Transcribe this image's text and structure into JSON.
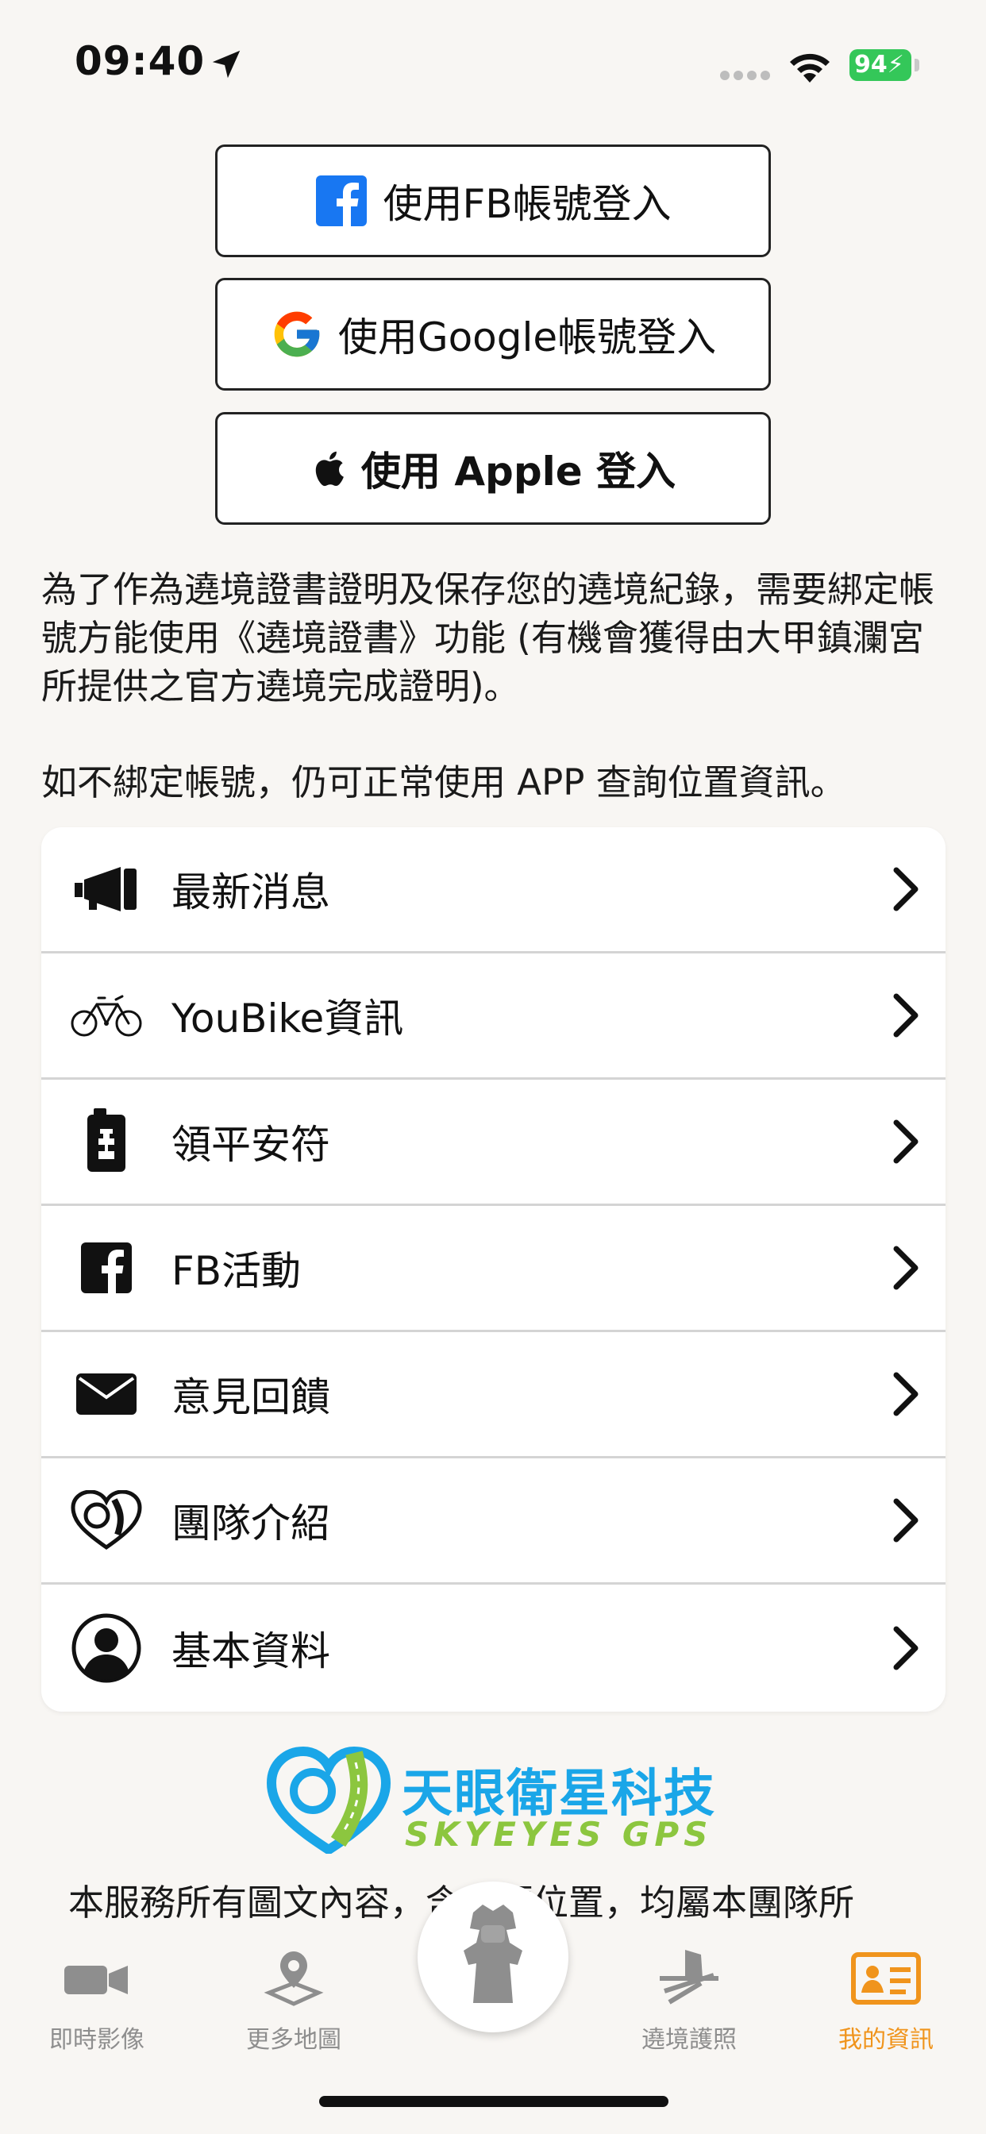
{
  "status_bar": {
    "time": "09:40",
    "battery": "94"
  },
  "login": {
    "fb_label": "使用FB帳號登入",
    "google_label": "使用Google帳號登入",
    "apple_label": "使用 Apple 登入"
  },
  "info": {
    "paragraph1": "為了作為遶境證書證明及保存您的遶境紀錄，需要綁定帳號方能使用《遶境證書》功能 (有機會獲得由大甲鎮瀾宮所提供之官方遶境完成證明)。",
    "paragraph2": "如不綁定帳號，仍可正常使用 APP 查詢位置資訊。"
  },
  "menu": {
    "items": [
      {
        "label": "最新消息",
        "icon": "megaphone-icon"
      },
      {
        "label": "YouBike資訊",
        "icon": "bicycle-icon"
      },
      {
        "label": "領平安符",
        "icon": "amulet-icon"
      },
      {
        "label": "FB活動",
        "icon": "facebook-icon"
      },
      {
        "label": "意見回饋",
        "icon": "envelope-icon"
      },
      {
        "label": "團隊介紹",
        "icon": "team-logo-icon"
      },
      {
        "label": "基本資料",
        "icon": "user-profile-icon"
      }
    ]
  },
  "brand": {
    "name_cn": "天眼衛星科技",
    "name_en": "SKYEYES GPS"
  },
  "footer": {
    "text": "本服務所有圖文內容，含坐標位置，均屬本團隊所"
  },
  "tab_bar": {
    "tabs": [
      {
        "label": "即時影像",
        "icon": "video-camera-icon"
      },
      {
        "label": "更多地圖",
        "icon": "map-pin-icon"
      },
      {
        "label": "遶境護照",
        "icon": "passport-icon"
      },
      {
        "label": "我的資訊",
        "icon": "id-card-icon"
      }
    ],
    "active_color": "#f0941c",
    "inactive_color": "#8e8e8e"
  },
  "colors": {
    "background": "#f8f6f3",
    "facebook_blue": "#1877f2",
    "brand_blue": "#1aa6e8",
    "brand_green": "#8cc63f"
  }
}
